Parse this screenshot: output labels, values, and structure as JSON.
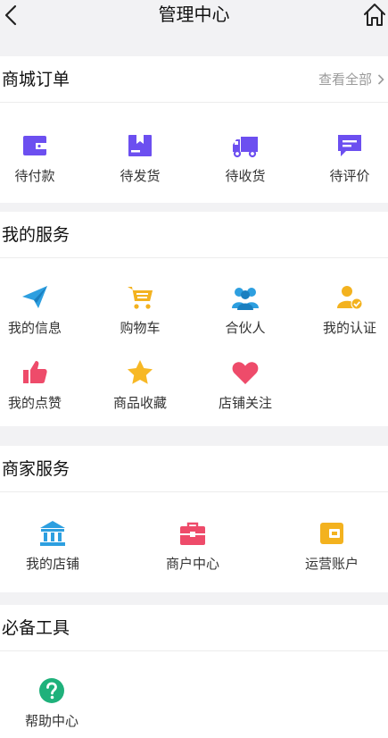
{
  "header": {
    "title": "管理中心"
  },
  "orders": {
    "title": "商城订单",
    "more": "查看全部",
    "items": [
      {
        "label": "待付款",
        "icon": "wallet-icon",
        "color": "#6c4ff0"
      },
      {
        "label": "待发货",
        "icon": "package-icon",
        "color": "#6c4ff0"
      },
      {
        "label": "待收货",
        "icon": "truck-icon",
        "color": "#6c4ff0"
      },
      {
        "label": "待评价",
        "icon": "comment-icon",
        "color": "#6c4ff0"
      }
    ]
  },
  "services": {
    "title": "我的服务",
    "items": [
      {
        "label": "我的信息",
        "icon": "paper-plane-icon",
        "color": "#2d9fe0"
      },
      {
        "label": "购物车",
        "icon": "cart-icon",
        "color": "#f3b21f"
      },
      {
        "label": "合伙人",
        "icon": "partners-icon",
        "color": "#2d9fe0"
      },
      {
        "label": "我的认证",
        "icon": "verified-user-icon",
        "color": "#f3b21f"
      },
      {
        "label": "我的点赞",
        "icon": "thumbs-up-icon",
        "color": "#ee4b6a"
      },
      {
        "label": "商品收藏",
        "icon": "star-icon",
        "color": "#f7b825"
      },
      {
        "label": "店铺关注",
        "icon": "heart-icon",
        "color": "#ee4b6a"
      }
    ]
  },
  "merchant": {
    "title": "商家服务",
    "items": [
      {
        "label": "我的店铺",
        "icon": "store-icon",
        "color": "#2d9fe0"
      },
      {
        "label": "商户中心",
        "icon": "briefcase-icon",
        "color": "#ee4b6a"
      },
      {
        "label": "运营账户",
        "icon": "account-wallet-icon",
        "color": "#f3b21f"
      }
    ]
  },
  "tools": {
    "title": "必备工具",
    "items": [
      {
        "label": "帮助中心",
        "icon": "help-icon",
        "color": "#1fb17b"
      }
    ]
  }
}
